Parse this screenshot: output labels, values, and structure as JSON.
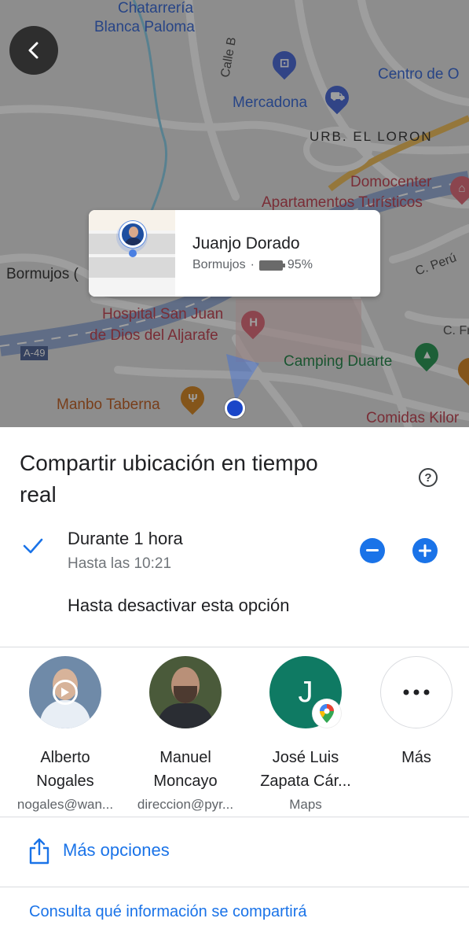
{
  "map": {
    "labels": {
      "chatarreria": "Chatarrería\nBlanca Paloma",
      "calle_b": "Calle B",
      "centro": "Centro de O",
      "mercadona": "Mercadona",
      "urb": "URB. EL LORON",
      "domocenter": "Domocenter",
      "apartamentos": "Apartamentos Turísticos",
      "bormujos": "Bormujos (",
      "c_peru": "C. Perú",
      "hospital_1": "Hospital San Juan",
      "hospital_2": "de Dios del Aljarafe",
      "c_fr": "C. Fr",
      "a49": "A-49",
      "camping": "Camping Duarte",
      "manbo": "Manbo Taberna",
      "comidas": "Comidas Kilor"
    },
    "icons": [
      "back-icon",
      "shopping-bag-icon",
      "shopping-cart-icon",
      "hospital-icon",
      "restaurant-icon",
      "camping-icon",
      "hotel-icon"
    ]
  },
  "card": {
    "name": "Juanjo Dorado",
    "place": "Bormujos",
    "separator": "·",
    "battery": "95%"
  },
  "sheet": {
    "title": "Compartir ubicación en tiempo real",
    "help": "?",
    "option_hour": {
      "label": "Durante 1 hora",
      "sub": "Hasta las 10:21",
      "selected": true
    },
    "option_until_off": {
      "label": "Hasta desactivar esta opción"
    },
    "contacts": [
      {
        "name_line1": "Alberto",
        "name_line2": "Nogales",
        "sub": "nogales@wan..."
      },
      {
        "name_line1": "Manuel",
        "name_line2": "Moncayo",
        "sub": "direccion@pyr..."
      },
      {
        "initial": "J",
        "name_line1": "José Luis",
        "name_line2": "Zapata Cár...",
        "sub": "Maps"
      },
      {
        "name_line1": "Más"
      }
    ],
    "more_options": "Más opciones",
    "info_link": "Consulta qué información se compartirá"
  },
  "colors": {
    "accent": "#1a73e8",
    "contact_green": "#0f7a63"
  }
}
